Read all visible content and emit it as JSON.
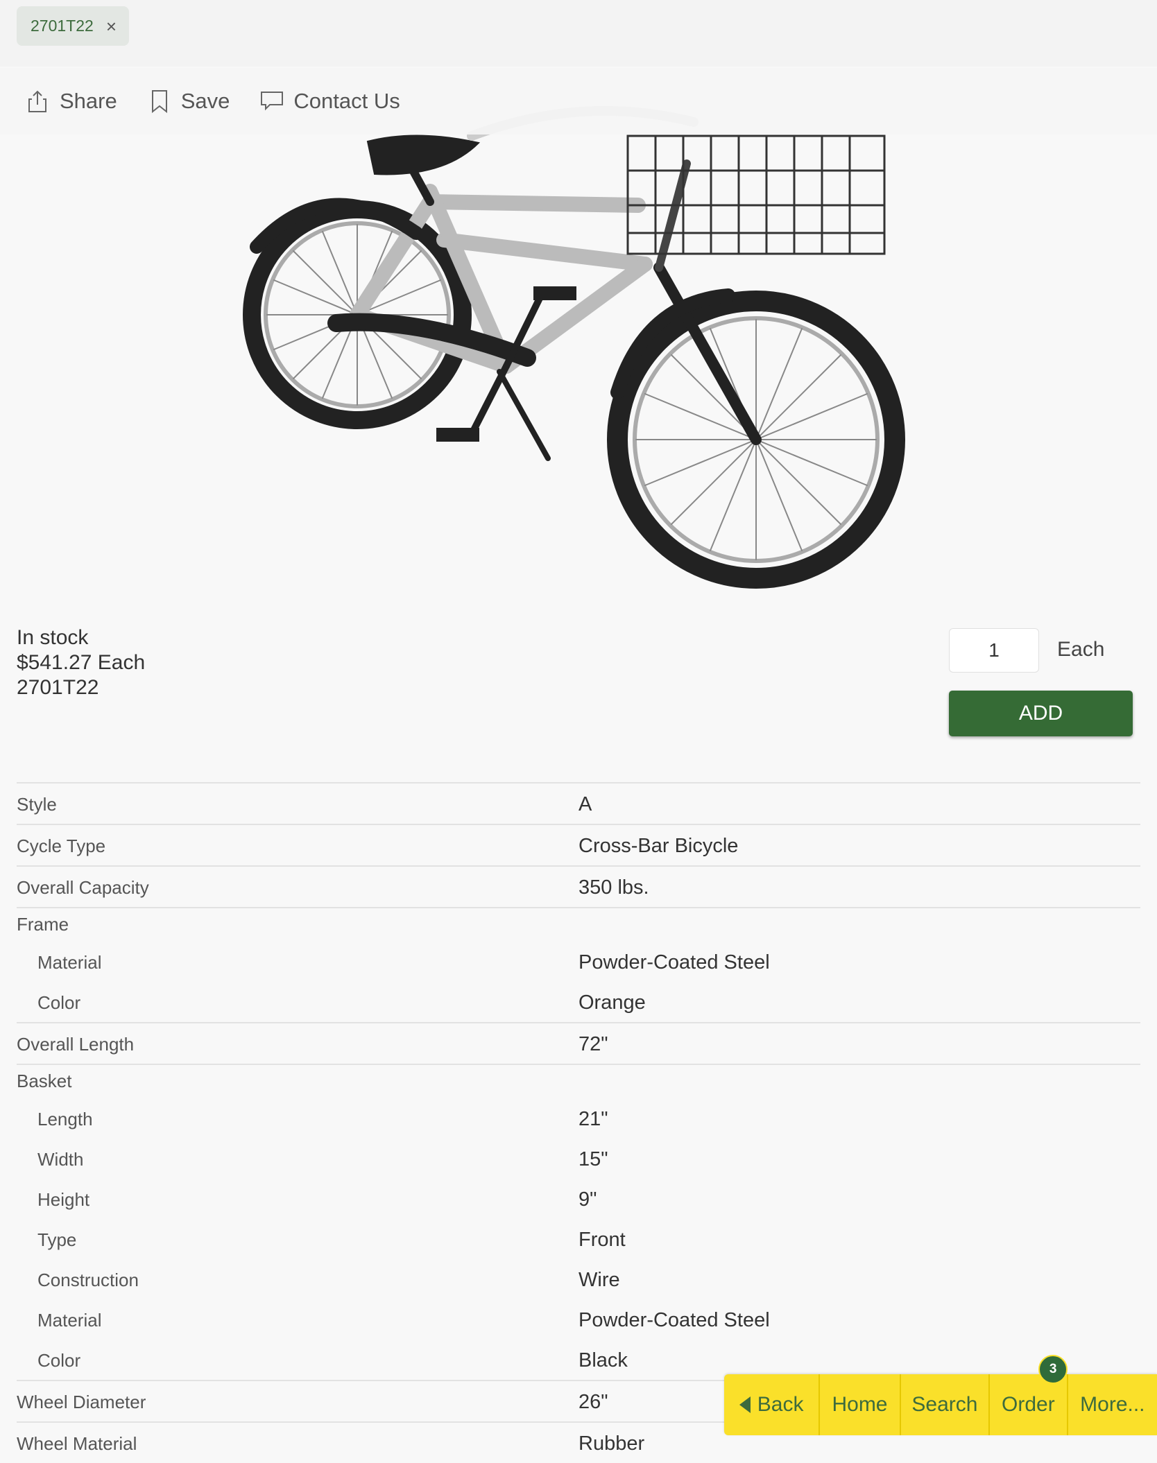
{
  "filter_chip": {
    "label": "2701T22",
    "remove_glyph": "×"
  },
  "actions": {
    "share": "Share",
    "save": "Save",
    "contact": "Contact Us"
  },
  "product": {
    "stock": "In stock",
    "price": "$541.27 Each",
    "part_number": "2701T22",
    "quantity": "1",
    "unit": "Each",
    "add_label": "ADD"
  },
  "specs": [
    {
      "label": "Style",
      "value": "A"
    },
    {
      "label": "Cycle Type",
      "value": "Cross-Bar Bicycle"
    },
    {
      "label": "Overall Capacity",
      "value": "350 lbs."
    },
    {
      "label": "Frame",
      "value": ""
    },
    {
      "label": "Material",
      "value": "Powder-Coated Steel"
    },
    {
      "label": "Color",
      "value": "Orange"
    },
    {
      "label": "Overall Length",
      "value": "72\""
    },
    {
      "label": "Basket",
      "value": ""
    },
    {
      "label": "Length",
      "value": "21\""
    },
    {
      "label": "Width",
      "value": "15\""
    },
    {
      "label": "Height",
      "value": "9\""
    },
    {
      "label": "Type",
      "value": "Front"
    },
    {
      "label": "Construction",
      "value": "Wire"
    },
    {
      "label": "Material",
      "value": "Powder-Coated Steel"
    },
    {
      "label": "Color",
      "value": "Black"
    },
    {
      "label": "Wheel Diameter",
      "value": "26\""
    },
    {
      "label": "Wheel Material",
      "value": "Rubber"
    }
  ],
  "bottom_nav": {
    "back": "Back",
    "home": "Home",
    "search": "Search",
    "order": "Order",
    "order_count": "3",
    "more": "More..."
  },
  "colors": {
    "accent_green": "#356b35",
    "nav_yellow": "#fae02a",
    "chip_text": "#3d6b3d"
  },
  "icons": [
    "share-icon",
    "bookmark-icon",
    "chat-icon",
    "close-icon",
    "back-arrow-icon"
  ]
}
